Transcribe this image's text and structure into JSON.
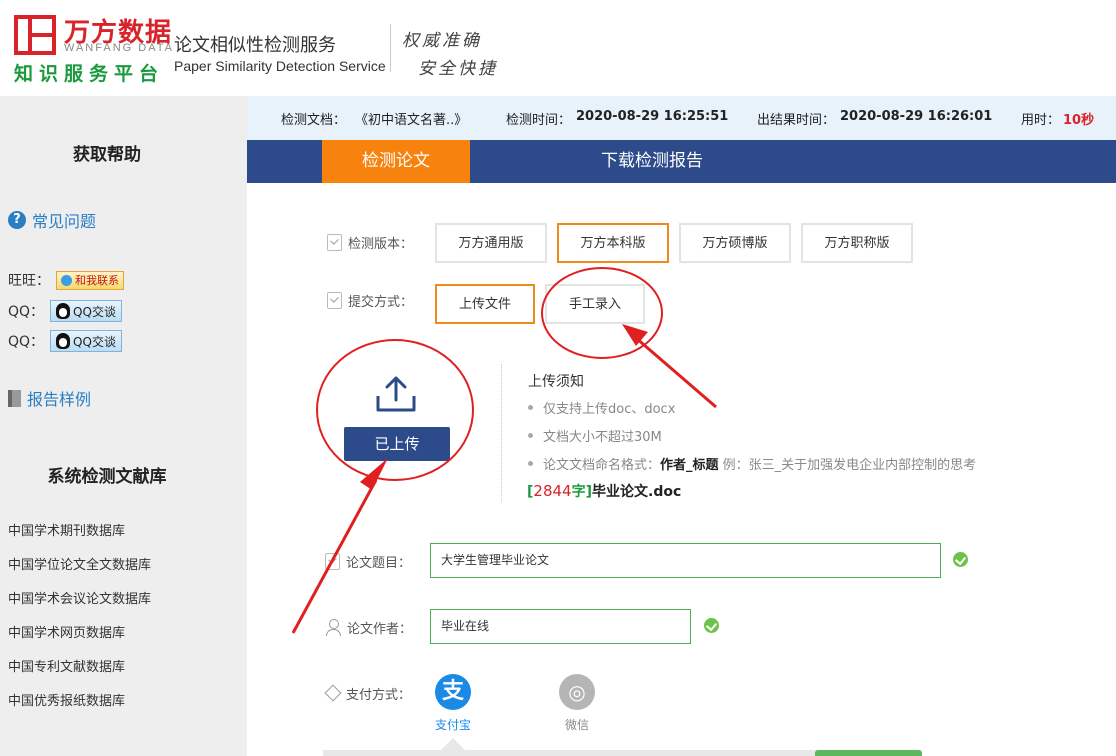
{
  "header": {
    "brand_name": "万方数据",
    "brand_en": "WANFANG DATA",
    "brand_slogan": "知识服务平台",
    "service_cn": "论文相似性检测服务",
    "service_en": "Paper Similarity Detection Service",
    "tagline_1": "权威准确",
    "tagline_2": "安全快捷"
  },
  "sidebar": {
    "help_title": "获取帮助",
    "faq_label": "常见问题",
    "contacts": [
      {
        "label": "旺旺：",
        "button": "和我联系"
      },
      {
        "label": "QQ：",
        "button": "QQ交谈"
      },
      {
        "label": "QQ：",
        "button": "QQ交谈"
      }
    ],
    "report_sample": "报告样例",
    "db_title": "系统检测文献库",
    "databases": [
      "中国学术期刊数据库",
      "中国学位论文全文数据库",
      "中国学术会议论文数据库",
      "中国学术网页数据库",
      "中国专利文献数据库",
      "中国优秀报纸数据库"
    ]
  },
  "infobar": {
    "doc_label": "检测文档：",
    "doc_value": "《初中语文名著..》",
    "time_label": "检测时间：",
    "time_value": "2020-08-29 16:25:51",
    "result_label": "出结果时间：",
    "result_value": "2020-08-29 16:26:01",
    "duration_label": "用时：",
    "duration_value": "10秒"
  },
  "tabs": [
    "检测论文",
    "下载检测报告"
  ],
  "form": {
    "version_label": "检测版本：",
    "versions": [
      "万方通用版",
      "万方本科版",
      "万方硕博版",
      "万方职称版"
    ],
    "selected_version": "万方本科版",
    "submit_label": "提交方式：",
    "submit_methods": [
      "上传文件",
      "手工录入"
    ],
    "selected_submit": "上传文件",
    "upload_button": "已上传",
    "notice": {
      "title": "上传须知",
      "items": [
        "仅支持上传doc、docx",
        "文档大小不超过30M"
      ],
      "naming_prefix": "论文文档命名格式：",
      "naming_format": "作者_标题",
      "naming_example": "例：张三_关于加强发电企业内部控制的思考"
    },
    "file": {
      "open": "[",
      "count": "2844",
      "unit": "字",
      "close": "]",
      "name": "毕业论文.doc"
    },
    "title_label": "论文题目：",
    "title_value": "大学生管理毕业论文",
    "author_label": "论文作者：",
    "author_value": "毕业在线",
    "payment_label": "支付方式：",
    "payments": [
      {
        "name": "支付宝",
        "glyph": "支",
        "color": "#1a8ae5"
      },
      {
        "name": "微信",
        "glyph": "◎",
        "color": "#b5b5b5"
      }
    ]
  },
  "colors": {
    "brand_red": "#d8232a",
    "nav_blue": "#2d4a8a",
    "tab_orange": "#f7820d",
    "valid_green": "#6cc24a",
    "annotation_red": "#e02020"
  }
}
